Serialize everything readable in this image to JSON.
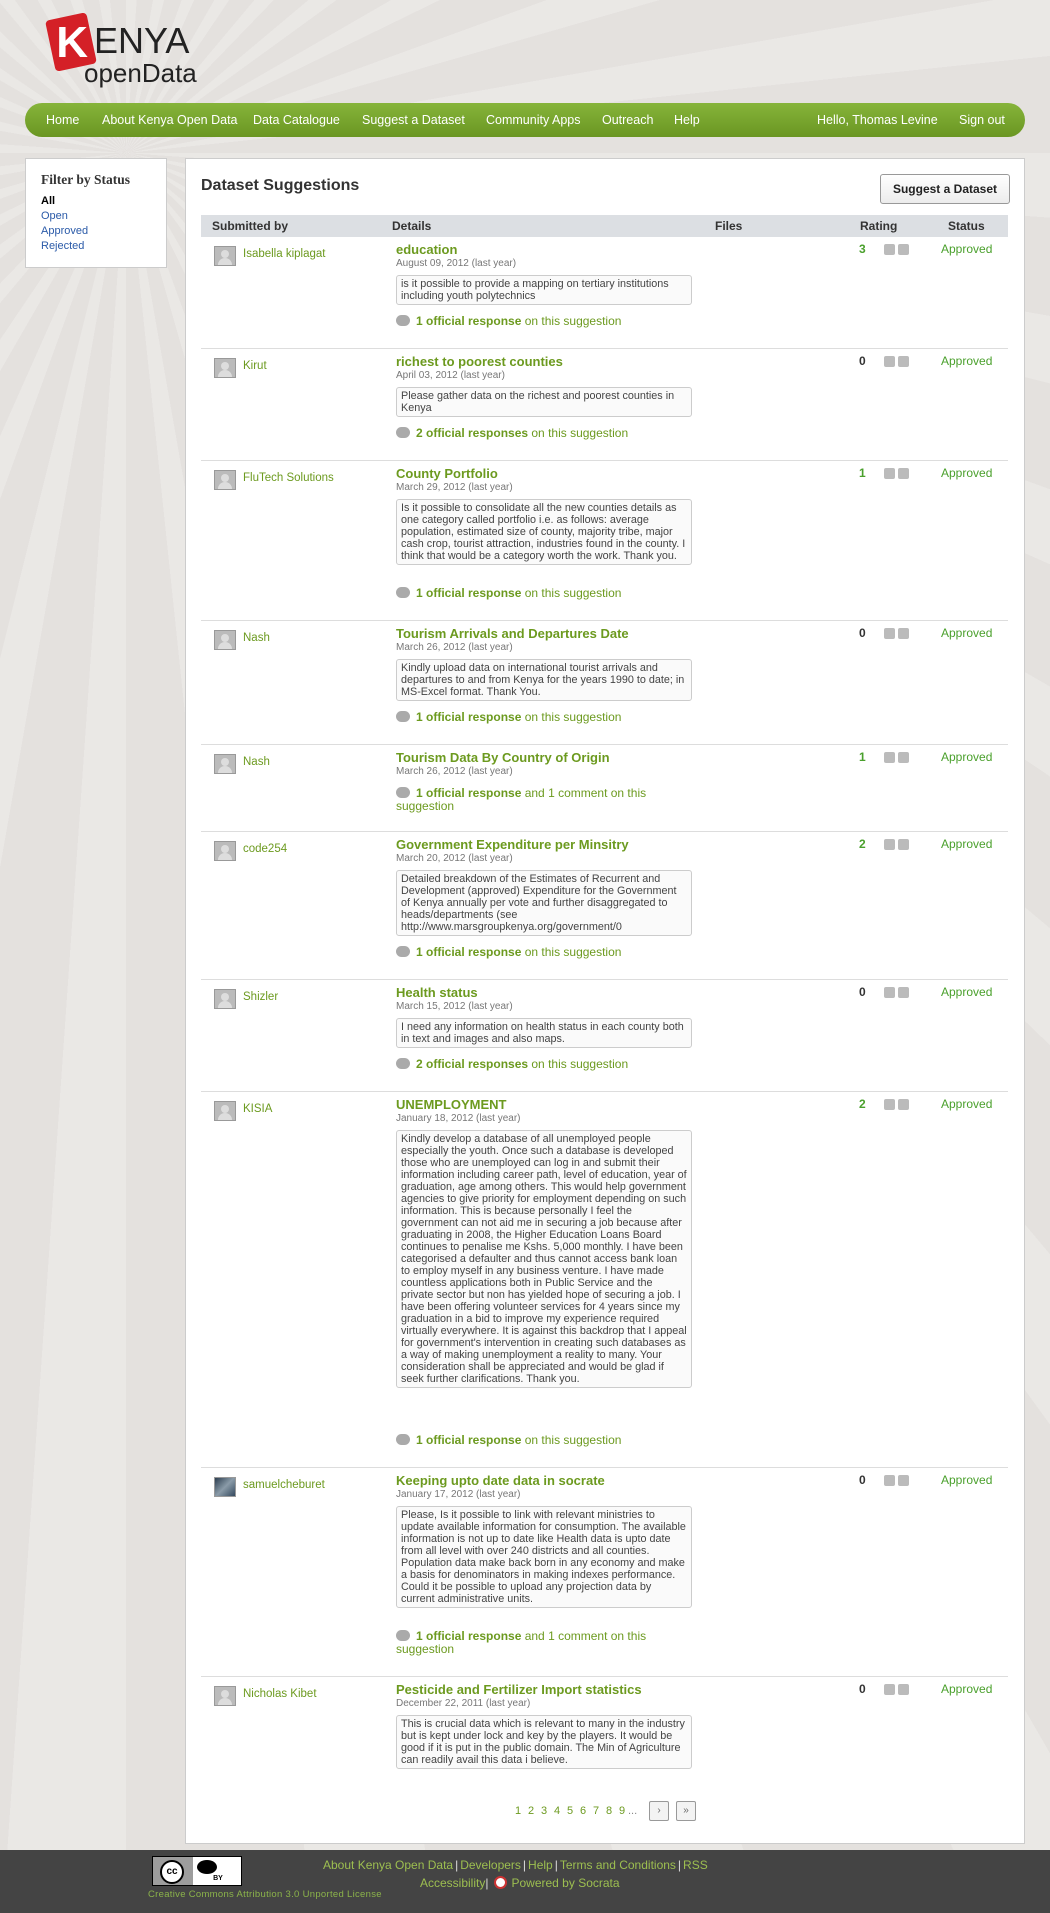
{
  "logo": {
    "k": "K",
    "enya": "ENYA",
    "open_data": "openData"
  },
  "nav": {
    "items": [
      "Home",
      "About Kenya Open Data",
      "Data Catalogue",
      "Suggest a Dataset",
      "Community Apps",
      "Outreach",
      "Help"
    ],
    "greeting": "Hello, Thomas Levine",
    "signout": "Sign out"
  },
  "filter": {
    "title": "Filter by Status",
    "options": [
      "All",
      "Open",
      "Approved",
      "Rejected"
    ],
    "selected": "All"
  },
  "main": {
    "title": "Dataset Suggestions",
    "suggest_button": "Suggest a Dataset",
    "columns": [
      "Submitted by",
      "Details",
      "Files",
      "Rating",
      "Status"
    ]
  },
  "suggestions": [
    {
      "user": "Isabella kiplagat",
      "title": "education",
      "date": "August 09, 2012 (last year)",
      "desc": "is it possible to provide a mapping on tertiary institutions including youth polytechnics",
      "resp_bold": "1 official response",
      "resp_rest": " on this suggestion",
      "rating": "3",
      "status": "Approved"
    },
    {
      "user": "Kirut",
      "title": "richest to poorest counties",
      "date": "April 03, 2012 (last year)",
      "desc": "Please gather data on the richest and poorest counties in Kenya",
      "resp_bold": "2 official responses",
      "resp_rest": " on this suggestion",
      "rating": "0",
      "status": "Approved"
    },
    {
      "user": "FluTech Solutions",
      "title": "County Portfolio",
      "date": "March 29, 2012 (last year)",
      "desc": "Is it possible to consolidate all the new counties details as one category called portfolio i.e. as follows: average population, estimated size of county, majority tribe, major cash crop, tourist attraction, industries found in the county. I think that would be a category worth the work. Thank you.",
      "resp_bold": "1 official response",
      "resp_rest": " on this suggestion",
      "rating": "1",
      "status": "Approved"
    },
    {
      "user": "Nash",
      "title": "Tourism Arrivals and Departures Date",
      "date": "March 26, 2012 (last year)",
      "desc": "Kindly upload data on international tourist arrivals and departures to and from Kenya for the years 1990 to date; in MS-Excel format. Thank You.",
      "resp_bold": "1 official response",
      "resp_rest": " on this suggestion",
      "rating": "0",
      "status": "Approved"
    },
    {
      "user": "Nash",
      "title": "Tourism Data By Country of Origin",
      "date": "March 26, 2012 (last year)",
      "desc": "",
      "resp_bold": "1 official response",
      "resp_rest": " and 1 comment on this suggestion",
      "rating": "1",
      "status": "Approved"
    },
    {
      "user": "code254",
      "title": "Government Expenditure per Minsitry",
      "date": "March 20, 2012 (last year)",
      "desc": "Detailed breakdown of the Estimates of Recurrent and Development (approved) Expenditure for the Government of Kenya annually per vote and further disaggregated to heads/departments (see http://www.marsgroupkenya.org/government/0",
      "resp_bold": "1 official response",
      "resp_rest": " on this suggestion",
      "rating": "2",
      "status": "Approved"
    },
    {
      "user": "Shizler",
      "title": "Health status",
      "date": "March 15, 2012 (last year)",
      "desc": "I need any information on health status in each county both in text and images and also maps.",
      "resp_bold": "2 official responses",
      "resp_rest": " on this suggestion",
      "rating": "0",
      "status": "Approved"
    },
    {
      "user": "KISIA",
      "title": "UNEMPLOYMENT",
      "date": "January 18, 2012 (last year)",
      "desc": "Kindly develop a database of all unemployed people especially the youth. Once such a database is developed those who are unemployed can log in and submit their information including career path, level of education, year of graduation, age among others. This would help government agencies to give priority for employment depending on such information. This is because personally I feel the government can not aid me in securing a job because after graduating in 2008, the Higher Education Loans Board continues to penalise me Kshs. 5,000 monthly. I have been categorised a defaulter and thus cannot access bank loan to employ myself in any business venture. I have made countless applications both in Public Service and the private sector but non has yielded hope of securing a job. I have been offering volunteer services for 4 years since my graduation in a bid to improve my experience required virtually everywhere. It is against this backdrop that I appeal for government's intervention in creating such databases as a way of making unemployment a reality to many. Your consideration shall be appreciated and would be glad if seek further clarifications. Thank you.",
      "resp_bold": "1 official response",
      "resp_rest": " on this suggestion",
      "rating": "2",
      "status": "Approved"
    },
    {
      "user": "samuelcheburet",
      "title": "Keeping upto date data in socrate",
      "date": "January 17, 2012 (last year)",
      "desc": "Please, Is it possible to link with relevant ministries to update available information for consumption. The available information is not up to date like Health data is upto date from all level with over 240 districts and all counties. Population data make back born in any economy and make a basis for denominators in making indexes performance. Could it be possible to upload any projection data by current administrative units.",
      "resp_bold": "1 official response",
      "resp_rest": " and 1 comment on this suggestion",
      "rating": "0",
      "status": "Approved"
    },
    {
      "user": "Nicholas Kibet",
      "title": "Pesticide and Fertilizer Import statistics",
      "date": "December 22, 2011 (last year)",
      "desc": "This is crucial data which is relevant to many in the industry but is kept under lock and key by the players. It would be good if it is put in the public domain. The Min of Agriculture can readily avail this data i believe.",
      "resp_bold": "",
      "resp_rest": "",
      "rating": "0",
      "status": "Approved"
    }
  ],
  "pager": {
    "pages": [
      "1",
      "2",
      "3",
      "4",
      "5",
      "6",
      "7",
      "8",
      "9"
    ],
    "ellipsis": "...",
    "next": "›",
    "last": "»"
  },
  "footer": {
    "links": [
      "About Kenya Open Data",
      "Developers",
      "Help",
      "Terms and Conditions",
      "RSS"
    ],
    "accessibility": "Accessibility",
    "powered": "Powered by Socrata",
    "license": "Creative Commons Attribution 3.0 Unported License",
    "cc_label": "cc",
    "by_label": "BY"
  },
  "colors": {
    "accent_green": "#6c9a1f",
    "nav_green": "#7aa630",
    "approved": "#4aa02c",
    "link_blue": "#2a5aa8"
  }
}
